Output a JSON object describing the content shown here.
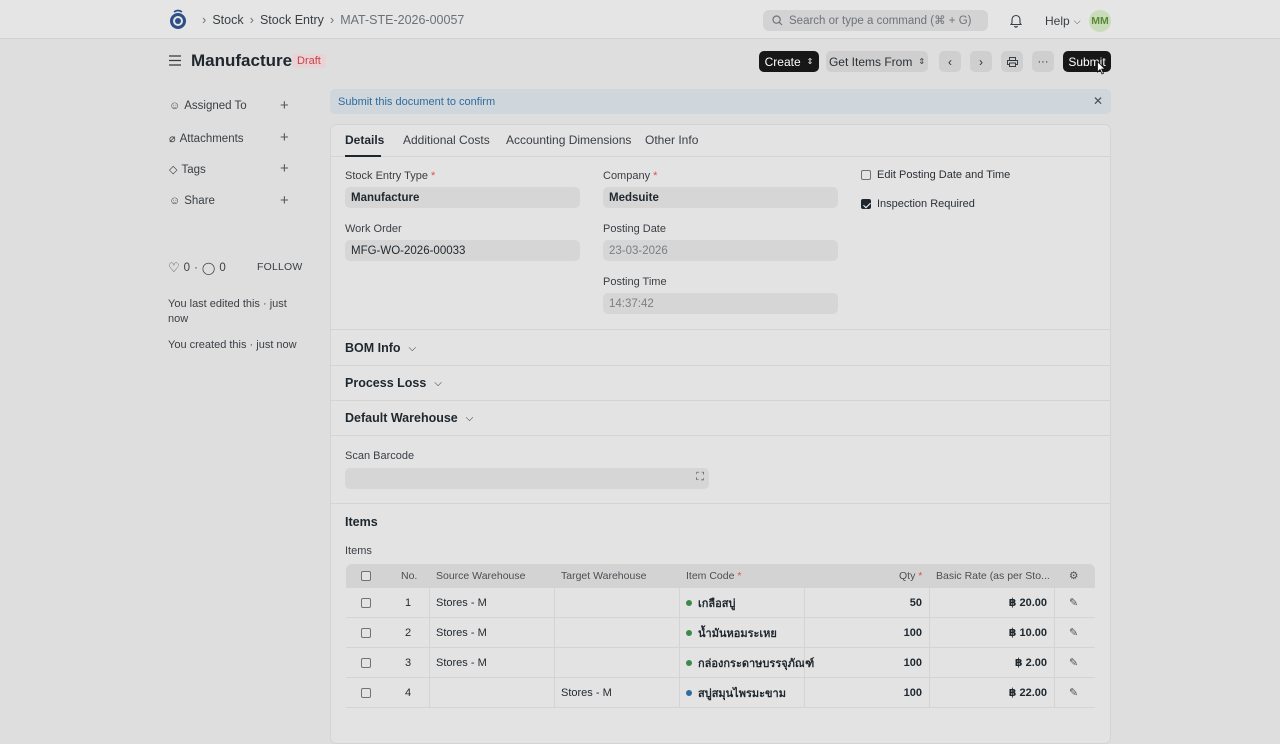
{
  "navbar": {
    "breadcrumbs": [
      "Stock",
      "Stock Entry",
      "MAT-STE-2026-00057"
    ],
    "search_placeholder": "Search or type a command (⌘ + G)",
    "help_label": "Help",
    "avatar_initials": "MM"
  },
  "page": {
    "title": "Manufacture",
    "status": "Draft",
    "actions": {
      "create": "Create",
      "get_items_from": "Get Items From",
      "submit": "Submit"
    }
  },
  "sidebar": {
    "items": [
      {
        "label": "Assigned To"
      },
      {
        "label": "Attachments"
      },
      {
        "label": "Tags"
      },
      {
        "label": "Share"
      }
    ],
    "likes": "0",
    "comments": "0",
    "follow": "FOLLOW",
    "activity": [
      "You last edited this · just now",
      "You created this · just now"
    ]
  },
  "alert": {
    "message": "Submit this document to confirm"
  },
  "tabs": [
    "Details",
    "Additional Costs",
    "Accounting Dimensions",
    "Other Info"
  ],
  "form": {
    "stock_entry_type": {
      "label": "Stock Entry Type",
      "value": "Manufacture"
    },
    "work_order": {
      "label": "Work Order",
      "value": "MFG-WO-2026-00033"
    },
    "company": {
      "label": "Company",
      "value": "Medsuite"
    },
    "posting_date": {
      "label": "Posting Date",
      "value": "23-03-2026"
    },
    "posting_time": {
      "label": "Posting Time",
      "value": "14:37:42"
    },
    "edit_posting": {
      "label": "Edit Posting Date and Time",
      "checked": false
    },
    "inspection_required": {
      "label": "Inspection Required",
      "checked": true
    },
    "sections": [
      "BOM Info",
      "Process Loss",
      "Default Warehouse"
    ],
    "scan_barcode_label": "Scan Barcode",
    "items_section": "Items",
    "items_label": "Items"
  },
  "table": {
    "headers": [
      "No.",
      "Source Warehouse",
      "Target Warehouse",
      "Item Code",
      "Qty",
      "Basic Rate (as per Sto..."
    ],
    "rows": [
      {
        "no": "1",
        "source": "Stores - M",
        "target": "",
        "item": "เกลือสบู่",
        "qty": "50",
        "rate": "฿ 20.00"
      },
      {
        "no": "2",
        "source": "Stores - M",
        "target": "",
        "item": "น้ำมันหอมระเหย",
        "qty": "100",
        "rate": "฿ 10.00"
      },
      {
        "no": "3",
        "source": "Stores - M",
        "target": "",
        "item": "กล่องกระดาษบรรจุภัณฑ์",
        "qty": "100",
        "rate": "฿ 2.00"
      },
      {
        "no": "4",
        "source": "",
        "target": "Stores - M",
        "item": "สบู่สมุนไพรมะขาม",
        "qty": "100",
        "rate": "฿ 22.00"
      }
    ]
  }
}
